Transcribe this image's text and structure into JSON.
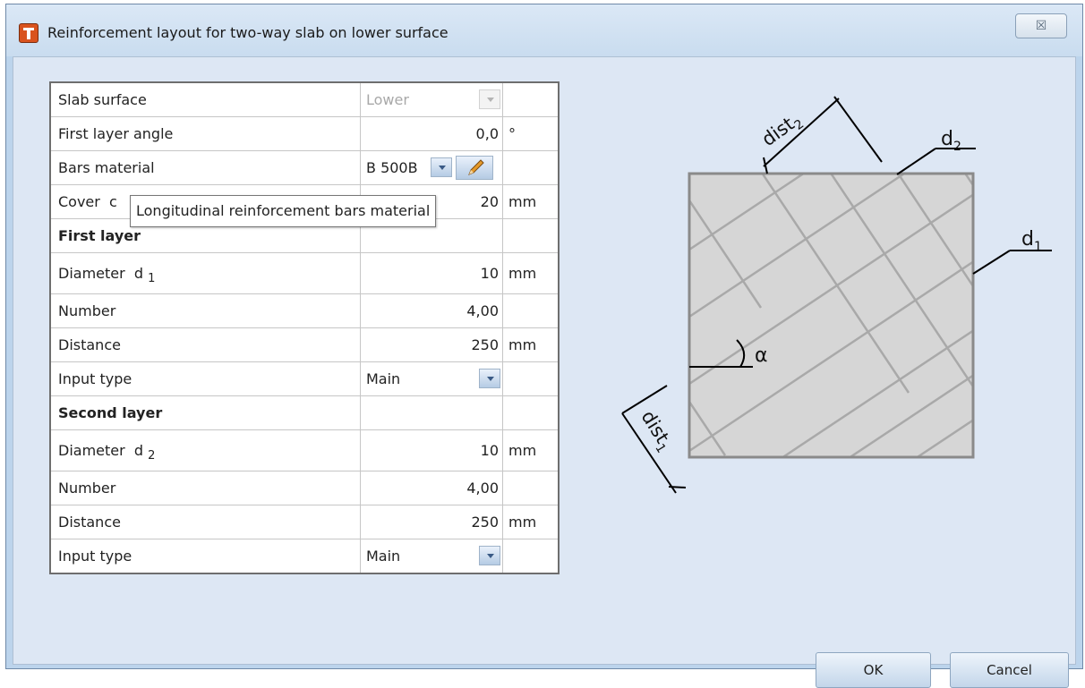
{
  "window": {
    "title": "Reinforcement layout for two-way slab on lower surface",
    "close_glyph": "☒"
  },
  "tooltip": {
    "text": "Longitudinal reinforcement bars material"
  },
  "rows": {
    "slab_surface": {
      "label": "Slab surface",
      "value": "Lower"
    },
    "first_layer_angle": {
      "label": "First layer angle",
      "value": "0,0",
      "unit": "°"
    },
    "bars_material": {
      "label": "Bars material",
      "value": "B 500B"
    },
    "cover": {
      "label": "Cover",
      "symbol": "c",
      "value": "20",
      "unit": "mm"
    }
  },
  "first_layer": {
    "heading": "First layer",
    "diameter": {
      "label": "Diameter",
      "symbol": "d",
      "sub": "1",
      "value": "10",
      "unit": "mm"
    },
    "number": {
      "label": "Number",
      "value": "4,00"
    },
    "distance": {
      "label": "Distance",
      "value": "250",
      "unit": "mm"
    },
    "input_type": {
      "label": "Input type",
      "value": "Main"
    }
  },
  "second_layer": {
    "heading": "Second layer",
    "diameter": {
      "label": "Diameter",
      "symbol": "d",
      "sub": "2",
      "value": "10",
      "unit": "mm"
    },
    "number": {
      "label": "Number",
      "value": "4,00"
    },
    "distance": {
      "label": "Distance",
      "value": "250",
      "unit": "mm"
    },
    "input_type": {
      "label": "Input type",
      "value": "Main"
    }
  },
  "diagram": {
    "dist2": "dist",
    "dist2_sub": "2",
    "d2": "d",
    "d2_sub": "2",
    "d1": "d",
    "d1_sub": "1",
    "alpha": "α",
    "dist1": "dist",
    "dist1_sub": "1"
  },
  "buttons": {
    "ok": "OK",
    "cancel": "Cancel"
  },
  "colors": {
    "window_bg": "#bcd4ec",
    "client_bg": "#dde7f4",
    "slab_fill": "#d6d6d6",
    "bar_lines": "#a9a9a9",
    "app_icon": "#d9531e"
  }
}
